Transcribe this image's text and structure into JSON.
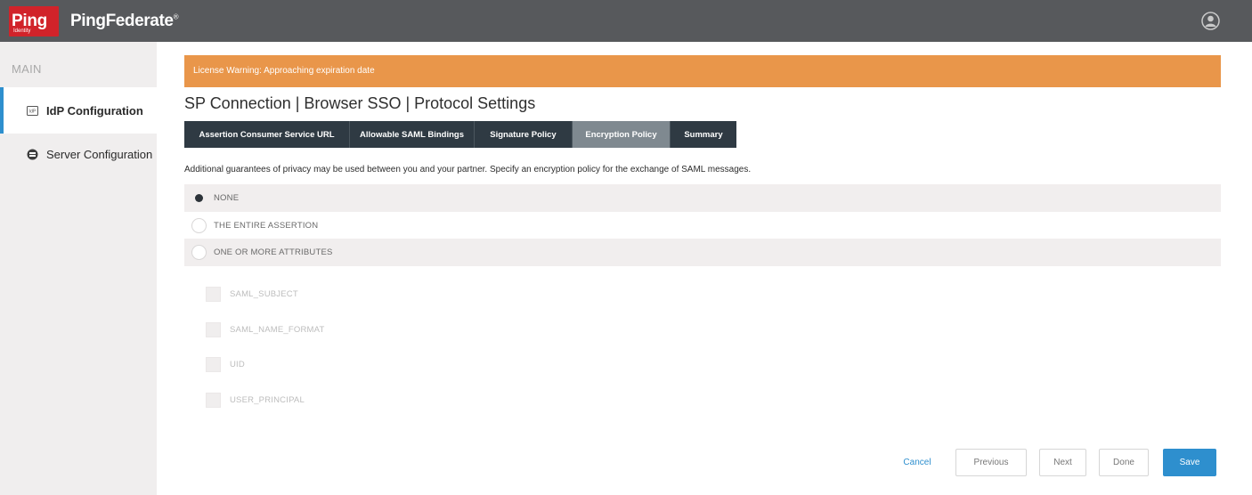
{
  "app": {
    "logo_text": "Ping",
    "logo_subtext": "Identity",
    "product_name": "PingFederate",
    "product_mark": "®",
    "brand_color": "#d1232a",
    "accent_color": "#2e8fce"
  },
  "header": {
    "user_icon": "user-circle-icon"
  },
  "sidebar": {
    "heading": "MAIN",
    "items": [
      {
        "label": "IdP Configuration",
        "icon": "idp-icon",
        "active": true
      },
      {
        "label": "Server Configuration",
        "icon": "server-icon",
        "active": false
      }
    ]
  },
  "main": {
    "license_warning": "License Warning: Approaching expiration date",
    "title": "SP Connection | Browser SSO | Protocol Settings",
    "tabs": [
      {
        "label": "Assertion Consumer Service URL",
        "current": false
      },
      {
        "label": "Allowable SAML Bindings",
        "current": false
      },
      {
        "label": "Signature Policy",
        "current": false
      },
      {
        "label": "Encryption Policy",
        "current": true
      },
      {
        "label": "Summary",
        "current": false
      }
    ],
    "description": "Additional guarantees of privacy may be used between you and your partner. Specify an encryption policy for the exchange of SAML messages.",
    "options": [
      {
        "label": "NONE",
        "checked": true
      },
      {
        "label": "THE ENTIRE ASSERTION",
        "checked": false
      },
      {
        "label": "ONE OR MORE ATTRIBUTES",
        "checked": false
      }
    ],
    "attributes": [
      {
        "label": "SAML_SUBJECT",
        "checked": false
      },
      {
        "label": "SAML_NAME_FORMAT",
        "checked": false
      },
      {
        "label": "UID",
        "checked": false
      },
      {
        "label": "USER_PRINCIPAL",
        "checked": false
      }
    ]
  },
  "footer": {
    "cancel_label": "Cancel",
    "previous_label": "Previous",
    "next_label": "Next",
    "done_label": "Done",
    "save_label": "Save"
  }
}
